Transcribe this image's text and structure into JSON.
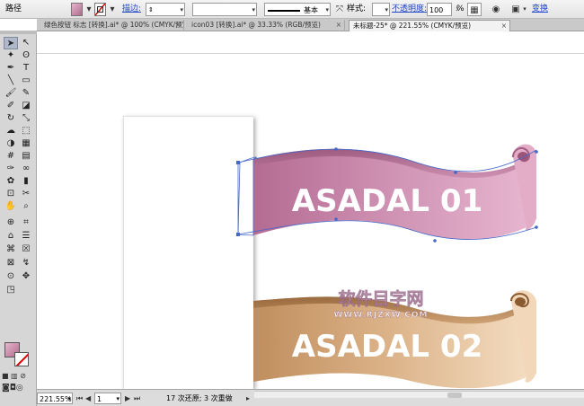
{
  "control_bar": {
    "object_type": "路径",
    "fill_color": "#c98aa6",
    "stroke_label": "描边:",
    "stroke_weight_value": "",
    "variable_width_value": "",
    "profile_label": "基本",
    "style_label": "样式:",
    "opacity_label": "不透明度:",
    "opacity_value": "100",
    "opacity_unit": "%",
    "transform_label": "变换"
  },
  "tabs": [
    {
      "label": "绿色按钮 标志 [转换].ai* @ 100% (CMYK/预览)"
    },
    {
      "label": "icon03 [转换].ai* @ 33.33% (RGB/预览)"
    },
    {
      "label": "未标题-25* @ 221.55% (CMYK/预览)",
      "active": true
    }
  ],
  "tools": [
    "selection-tool",
    "direct-selection-tool",
    "magic-wand-tool",
    "lasso-tool",
    "pen-tool",
    "type-tool",
    "line-tool",
    "rectangle-tool",
    "paintbrush-tool",
    "pencil-tool",
    "blob-brush-tool",
    "eraser-tool",
    "rotate-tool",
    "scale-tool",
    "warp-tool",
    "free-transform-tool",
    "shape-builder-tool",
    "perspective-grid-tool",
    "mesh-tool",
    "gradient-tool",
    "eyedropper-tool",
    "blend-tool",
    "symbol-sprayer-tool",
    "column-graph-tool",
    "artboard-tool",
    "slice-tool",
    "hand-tool",
    "zoom-tool"
  ],
  "banners": [
    {
      "text": "ASADAL 01",
      "color_top": "#dfa7c4",
      "color_bottom": "#b0688c"
    },
    {
      "text": "ASADAL 02",
      "color_top": "#f1d4b4",
      "color_bottom": "#b78659"
    }
  ],
  "watermark": {
    "title": "软件目字网",
    "url": "WWW.RJZXW.COM"
  },
  "status_bar": {
    "zoom": "221.55%",
    "page": "1",
    "history": "17 次还原; 3 次重做"
  }
}
